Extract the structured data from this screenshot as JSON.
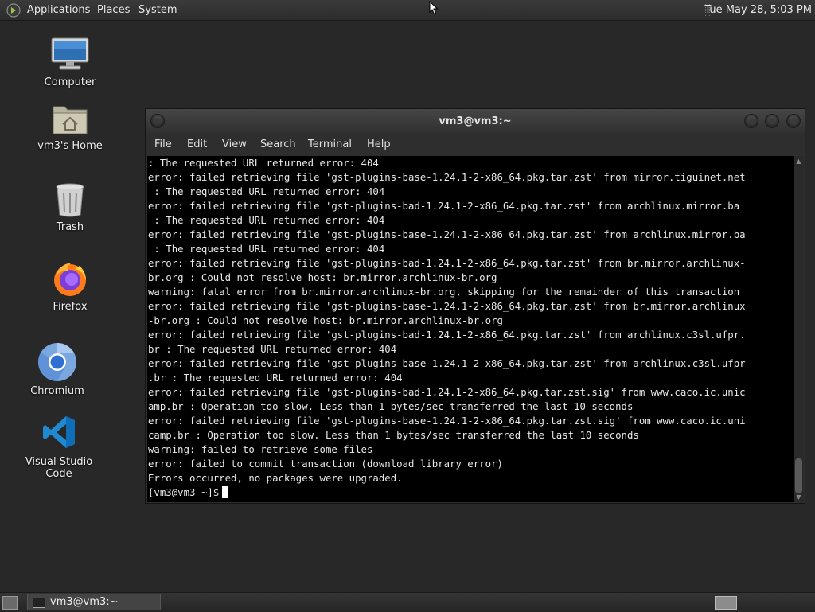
{
  "top_panel": {
    "menus": [
      "Applications",
      "Places",
      "System"
    ],
    "clock": "Tue May 28,  5:03 PM"
  },
  "desktop_icons": [
    {
      "label": "Computer",
      "icon": "computer-icon"
    },
    {
      "label": "vm3's Home",
      "icon": "home-folder-icon"
    },
    {
      "label": "Trash",
      "icon": "trash-icon"
    },
    {
      "label": "Firefox",
      "icon": "firefox-icon"
    },
    {
      "label": "Chromium",
      "icon": "chromium-icon"
    },
    {
      "label": "Visual Studio Code",
      "icon": "vscode-icon"
    }
  ],
  "window": {
    "title": "vm3@vm3:~",
    "menu": [
      "File",
      "Edit",
      "View",
      "Search",
      "Terminal",
      "Help"
    ]
  },
  "terminal": {
    "lines": [
      ": The requested URL returned error: 404",
      "error: failed retrieving file 'gst-plugins-base-1.24.1-2-x86_64.pkg.tar.zst' from mirror.tiguinet.net",
      " : The requested URL returned error: 404",
      "error: failed retrieving file 'gst-plugins-bad-1.24.1-2-x86_64.pkg.tar.zst' from archlinux.mirror.ba",
      " : The requested URL returned error: 404",
      "error: failed retrieving file 'gst-plugins-base-1.24.1-2-x86_64.pkg.tar.zst' from archlinux.mirror.ba",
      " : The requested URL returned error: 404",
      "error: failed retrieving file 'gst-plugins-bad-1.24.1-2-x86_64.pkg.tar.zst' from br.mirror.archlinux-",
      "br.org : Could not resolve host: br.mirror.archlinux-br.org",
      "warning: fatal error from br.mirror.archlinux-br.org, skipping for the remainder of this transaction",
      "error: failed retrieving file 'gst-plugins-base-1.24.1-2-x86_64.pkg.tar.zst' from br.mirror.archlinux",
      "-br.org : Could not resolve host: br.mirror.archlinux-br.org",
      "error: failed retrieving file 'gst-plugins-bad-1.24.1-2-x86_64.pkg.tar.zst' from archlinux.c3sl.ufpr.",
      "br : The requested URL returned error: 404",
      "error: failed retrieving file 'gst-plugins-base-1.24.1-2-x86_64.pkg.tar.zst' from archlinux.c3sl.ufpr",
      ".br : The requested URL returned error: 404",
      "error: failed retrieving file 'gst-plugins-bad-1.24.1-2-x86_64.pkg.tar.zst.sig' from www.caco.ic.unic",
      "amp.br : Operation too slow. Less than 1 bytes/sec transferred the last 10 seconds",
      "error: failed retrieving file 'gst-plugins-base-1.24.1-2-x86_64.pkg.tar.zst.sig' from www.caco.ic.uni",
      "camp.br : Operation too slow. Less than 1 bytes/sec transferred the last 10 seconds",
      "warning: failed to retrieve some files",
      "error: failed to commit transaction (download library error)",
      "Errors occurred, no packages were upgraded."
    ],
    "prompt": "[vm3@vm3 ~]$"
  },
  "taskbar": {
    "task_label": "vm3@vm3:~"
  }
}
